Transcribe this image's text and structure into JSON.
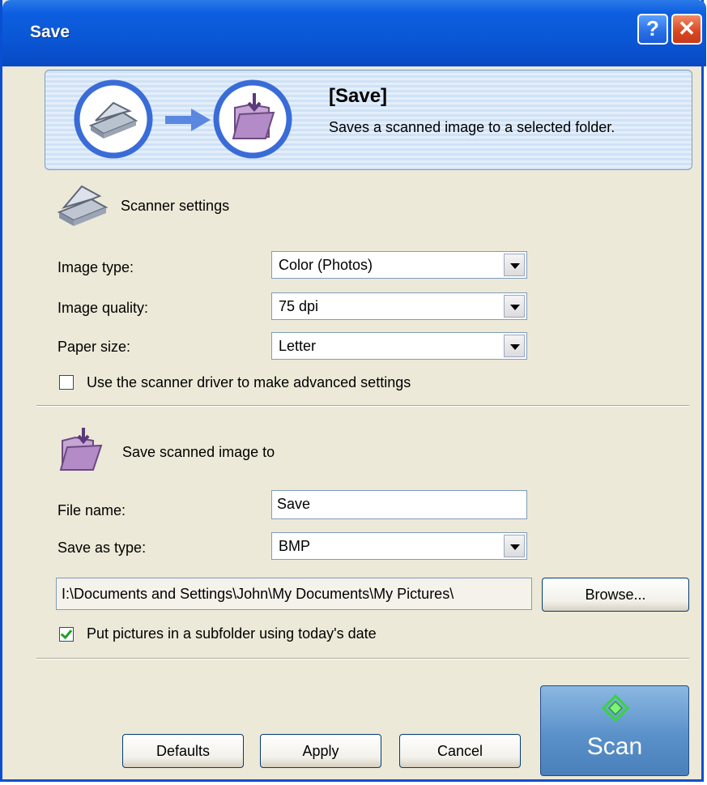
{
  "window": {
    "title": "Save"
  },
  "titlebar": {
    "help_icon": "help-icon",
    "close_icon": "close-icon"
  },
  "banner": {
    "title": "[Save]",
    "description": "Saves a scanned image to a selected folder.",
    "icons": [
      "scanner-icon",
      "arrow-right-icon",
      "save-folder-icon"
    ]
  },
  "scanner_settings": {
    "heading": "Scanner settings",
    "icon": "scanner-icon",
    "image_type": {
      "label": "Image type:",
      "value": "Color (Photos)"
    },
    "image_quality": {
      "label": "Image quality:",
      "value": "75 dpi"
    },
    "paper_size": {
      "label": "Paper size:",
      "value": "Letter"
    },
    "advanced_checkbox": {
      "label": "Use the scanner driver to make advanced settings",
      "checked": false
    }
  },
  "save_to": {
    "heading": "Save scanned image to",
    "icon": "save-folder-icon",
    "file_name": {
      "label": "File name:",
      "value": "Save"
    },
    "save_as_type": {
      "label": "Save as type:",
      "value": "BMP"
    },
    "path": {
      "value": "I:\\Documents and Settings\\John\\My Documents\\My Pictures\\"
    },
    "browse_label": "Browse...",
    "subfolder_checkbox": {
      "label": "Put pictures in a subfolder using today's date",
      "checked": true
    }
  },
  "buttons": {
    "defaults": "Defaults",
    "apply": "Apply",
    "cancel": "Cancel",
    "scan": "Scan"
  },
  "colors": {
    "titlebar": "#0a58d6",
    "window_bg": "#ece9d8",
    "scan_button": "#5b91c9",
    "annotation_pointer": "#e0141e"
  }
}
